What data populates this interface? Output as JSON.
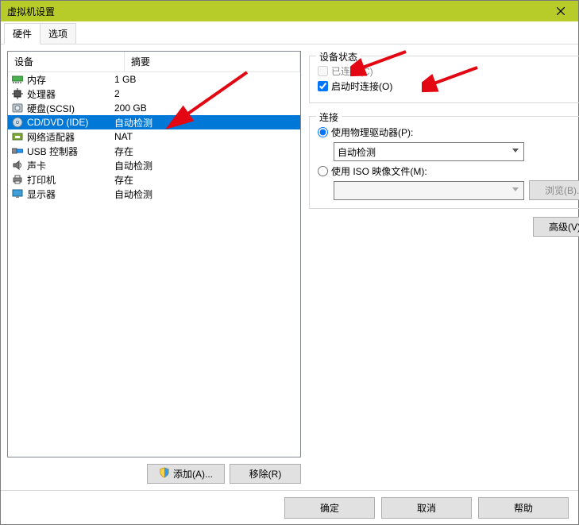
{
  "window": {
    "title": "虚拟机设置"
  },
  "tabs": {
    "hardware": "硬件",
    "options": "选项"
  },
  "columns": {
    "device": "设备",
    "summary": "摘要"
  },
  "devices": [
    {
      "icon": "memory",
      "name": "内存",
      "summary": "1 GB"
    },
    {
      "icon": "cpu",
      "name": "处理器",
      "summary": "2"
    },
    {
      "icon": "hdd",
      "name": "硬盘(SCSI)",
      "summary": "200 GB"
    },
    {
      "icon": "cd",
      "name": "CD/DVD (IDE)",
      "summary": "自动检测",
      "selected": true
    },
    {
      "icon": "nic",
      "name": "网络适配器",
      "summary": "NAT"
    },
    {
      "icon": "usb",
      "name": "USB 控制器",
      "summary": "存在"
    },
    {
      "icon": "sound",
      "name": "声卡",
      "summary": "自动检测"
    },
    {
      "icon": "printer",
      "name": "打印机",
      "summary": "存在"
    },
    {
      "icon": "display",
      "name": "显示器",
      "summary": "自动检测"
    }
  ],
  "leftButtons": {
    "add": "添加(A)...",
    "remove": "移除(R)"
  },
  "status": {
    "legend": "设备状态",
    "connected": "已连接(C)",
    "connectOnStart": "启动时连接(O)"
  },
  "connection": {
    "legend": "连接",
    "usePhysical": "使用物理驱动器(P):",
    "physicalValue": "自动检测",
    "useIso": "使用 ISO 映像文件(M):",
    "browse": "浏览(B)..."
  },
  "advanced": "高级(V)...",
  "footer": {
    "ok": "确定",
    "cancel": "取消",
    "help": "帮助"
  }
}
